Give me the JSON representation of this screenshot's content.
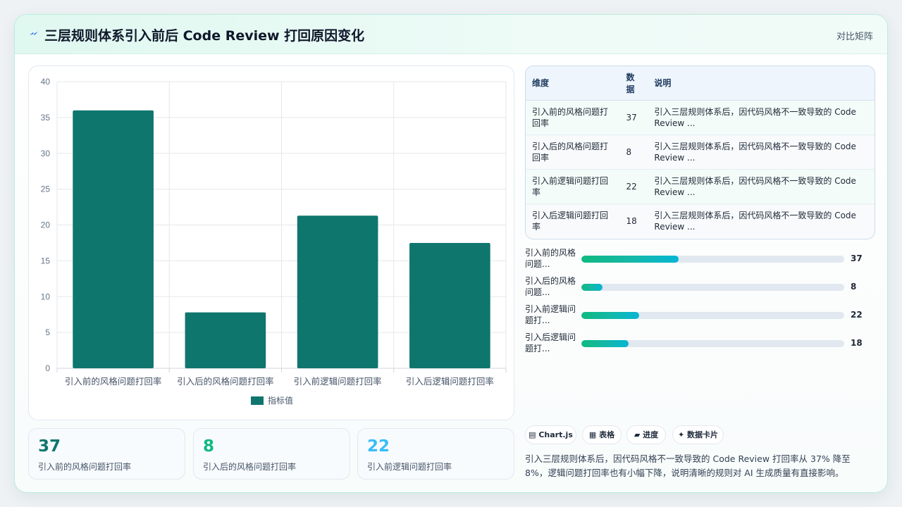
{
  "header": {
    "title": "三层规则体系引入前后 Code Review 打回原因变化",
    "right_label": "对比矩阵",
    "title_icon": "lightning-icon"
  },
  "chart_data": {
    "type": "bar",
    "categories": [
      "引入前的风格问题打回率",
      "引入后的风格问题打回率",
      "引入前逻辑问题打回率",
      "引入后逻辑问题打回率"
    ],
    "series": [
      {
        "name": "指标值",
        "values": [
          36,
          7.8,
          21.3,
          17.5
        ],
        "color": "#0f766e"
      }
    ],
    "ylim": [
      0,
      40
    ],
    "yticks": [
      0,
      5,
      10,
      15,
      20,
      25,
      30,
      35,
      40
    ],
    "grid": true,
    "legend": "bottom"
  },
  "stats": [
    {
      "value": "37",
      "label": "引入前的风格问题打回率",
      "color": "#0f766e"
    },
    {
      "value": "8",
      "label": "引入后的风格问题打回率",
      "color": "#10b981"
    },
    {
      "value": "22",
      "label": "引入前逻辑问题打回率",
      "color": "#38bdf8"
    }
  ],
  "table": {
    "headers": [
      "维度",
      "数据",
      "说明"
    ],
    "rows": [
      [
        "引入前的风格问题打回率",
        "37",
        "引入三层规则体系后，因代码风格不一致导致的 Code Review ..."
      ],
      [
        "引入后的风格问题打回率",
        "8",
        "引入三层规则体系后，因代码风格不一致导致的 Code Review ..."
      ],
      [
        "引入前逻辑问题打回率",
        "22",
        "引入三层规则体系后，因代码风格不一致导致的 Code Review ..."
      ],
      [
        "引入后逻辑问题打回率",
        "18",
        "引入三层规则体系后，因代码风格不一致导致的 Code Review ..."
      ]
    ]
  },
  "progress": {
    "max": 100,
    "items": [
      {
        "label": "引入前的风格问题...",
        "value": 37,
        "display": "37"
      },
      {
        "label": "引入后的风格问题...",
        "value": 8,
        "display": "8"
      },
      {
        "label": "引入前逻辑问题打...",
        "value": 22,
        "display": "22"
      },
      {
        "label": "引入后逻辑问题打...",
        "value": 18,
        "display": "18"
      }
    ]
  },
  "pills": [
    {
      "icon": "chart-icon",
      "glyph": "▤",
      "label": "Chart.js"
    },
    {
      "icon": "table-icon",
      "glyph": "▦",
      "label": "表格"
    },
    {
      "icon": "progress-icon",
      "glyph": "▰",
      "label": "进度"
    },
    {
      "icon": "sparkle-icon",
      "glyph": "✦",
      "label": "数据卡片"
    }
  ],
  "summary": "引入三层规则体系后，因代码风格不一致导致的 Code Review 打回率从 37% 降至 8%，逻辑问题打回率也有小幅下降，说明清晰的规则对 AI 生成质量有直接影响。"
}
